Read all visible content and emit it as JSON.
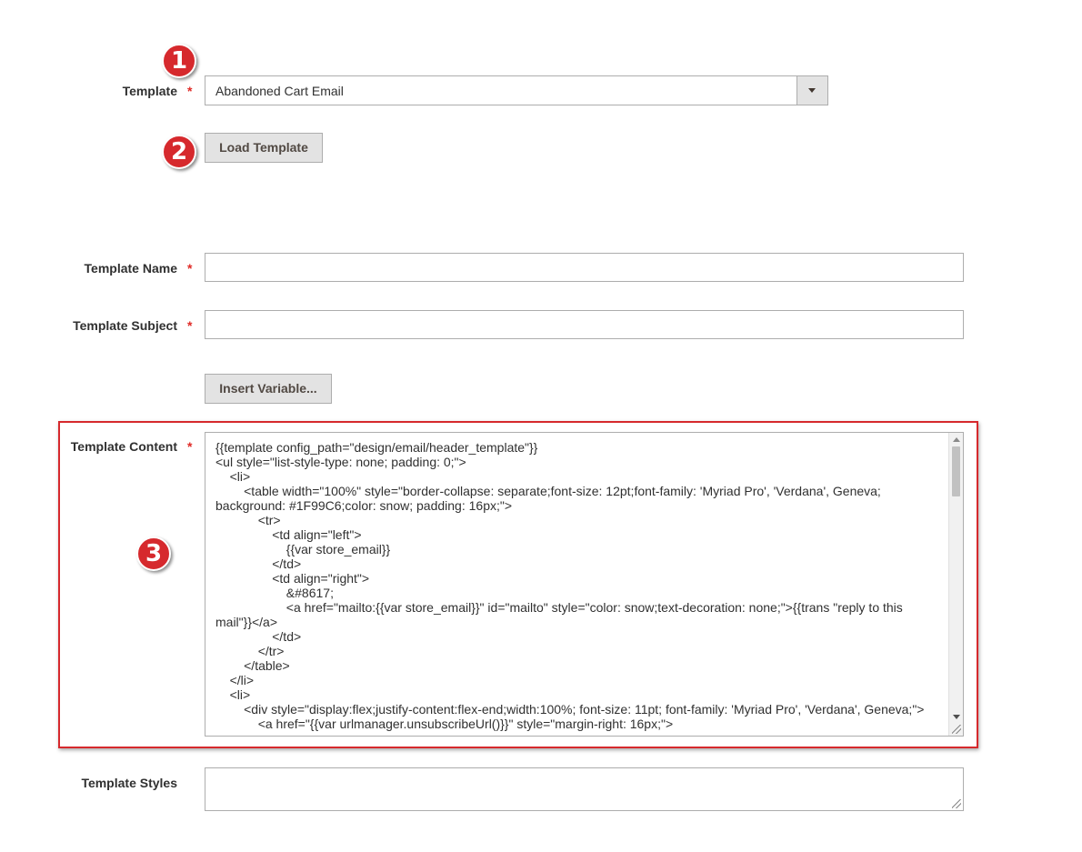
{
  "form": {
    "template": {
      "label": "Template",
      "required_mark": "*",
      "selected": "Abandoned Cart Email"
    },
    "load_template_button": "Load Template",
    "template_name": {
      "label": "Template Name",
      "required_mark": "*",
      "value": ""
    },
    "template_subject": {
      "label": "Template Subject",
      "required_mark": "*",
      "value": ""
    },
    "insert_variable_button": "Insert Variable...",
    "template_content": {
      "label": "Template Content",
      "required_mark": "*",
      "value": "{{template config_path=\"design/email/header_template\"}}\n<ul style=\"list-style-type: none; padding: 0;\">\n    <li>\n        <table width=\"100%\" style=\"border-collapse: separate;font-size: 12pt;font-family: 'Myriad Pro', 'Verdana', Geneva; background: #1F99C6;color: snow; padding: 16px;\">\n            <tr>\n                <td align=\"left\">\n                    {{var store_email}}\n                </td>\n                <td align=\"right\">\n                    &#8617;\n                    <a href=\"mailto:{{var store_email}}\" id=\"mailto\" style=\"color: snow;text-decoration: none;\">{{trans \"reply to this mail\"}}</a>\n                </td>\n            </tr>\n        </table>\n    </li>\n    <li>\n        <div style=\"display:flex;justify-content:flex-end;width:100%; font-size: 11pt; font-family: 'Myriad Pro', 'Verdana', Geneva;\">\n            <a href=\"{{var urlmanager.unsubscribeUrl()}}\" style=\"margin-right: 16px;\">"
    },
    "template_styles": {
      "label": "Template Styles",
      "value": ""
    }
  },
  "annotations": {
    "badge_1": "1",
    "badge_2": "2",
    "badge_3": "3",
    "color": "#d6292d"
  }
}
